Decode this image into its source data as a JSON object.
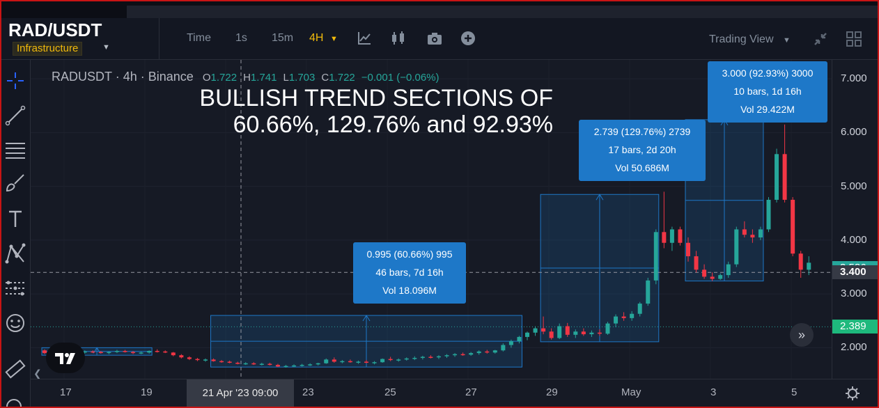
{
  "header": {
    "symbol": "RAD/USDT",
    "tag": "Infrastructure",
    "buttons": [
      "Time",
      "1s",
      "15m",
      "4H"
    ],
    "active_interval": "4H",
    "trading_view": "Trading View"
  },
  "legend": {
    "symbol": "RADUSDT",
    "interval": "4h",
    "exchange": "Binance",
    "o_label": "O",
    "o": "1.722",
    "h_label": "H",
    "h": "1.741",
    "l_label": "L",
    "l": "1.703",
    "c_label": "C",
    "c": "1.722",
    "change": "−0.001 (−0.06%)"
  },
  "annotation": {
    "line1": "BULLISH TREND SECTIONS OF",
    "line2": "60.66%, 129.76% and 92.93%"
  },
  "measures": [
    {
      "line1": "0.995 (60.66%) 995",
      "line2": "46 bars, 7d 16h",
      "line3": "Vol 18.096M"
    },
    {
      "line1": "2.739 (129.76%) 2739",
      "line2": "17 bars, 2d 20h",
      "line3": "Vol 50.686M"
    },
    {
      "line1": "3.000 (92.93%) 3000",
      "line2": "10 bars, 1d 16h",
      "line3": "Vol 29.422M"
    }
  ],
  "price_axis": {
    "labels": [
      "7.000",
      "6.000",
      "5.000",
      "4.000",
      "3.000",
      "2.000"
    ],
    "current_price": "2.389",
    "crosshair_price": "3.400",
    "partial_tag": "3.586"
  },
  "time_axis": {
    "labels": [
      "17",
      "19",
      "23",
      "25",
      "27",
      "29",
      "May",
      "3",
      "5"
    ],
    "crosshair_time": "21 Apr '23   09:00"
  },
  "chart_data": {
    "type": "candlestick",
    "ylim": [
      1.5,
      7.3
    ],
    "grid": true,
    "colors": {
      "up": "#26a69a",
      "down": "#f23645",
      "measure": "#1e78c8"
    },
    "candles": [
      [
        1.95,
        1.97,
        1.88,
        1.9
      ],
      [
        1.9,
        1.93,
        1.87,
        1.91
      ],
      [
        1.91,
        1.94,
        1.88,
        1.89
      ],
      [
        1.89,
        1.92,
        1.86,
        1.9
      ],
      [
        1.9,
        1.92,
        1.87,
        1.91
      ],
      [
        1.91,
        1.95,
        1.89,
        1.93
      ],
      [
        1.93,
        1.95,
        1.9,
        1.92
      ],
      [
        1.92,
        1.94,
        1.89,
        1.91
      ],
      [
        1.91,
        1.93,
        1.88,
        1.92
      ],
      [
        1.92,
        1.96,
        1.9,
        1.94
      ],
      [
        1.94,
        1.96,
        1.91,
        1.92
      ],
      [
        1.92,
        1.94,
        1.88,
        1.9
      ],
      [
        1.9,
        1.93,
        1.88,
        1.91
      ],
      [
        1.91,
        1.95,
        1.89,
        1.94
      ],
      [
        1.94,
        1.97,
        1.91,
        1.93
      ],
      [
        1.93,
        1.95,
        1.9,
        1.91
      ],
      [
        1.91,
        1.92,
        1.84,
        1.86
      ],
      [
        1.86,
        1.88,
        1.8,
        1.82
      ],
      [
        1.82,
        1.84,
        1.77,
        1.79
      ],
      [
        1.79,
        1.81,
        1.75,
        1.77
      ],
      [
        1.77,
        1.8,
        1.74,
        1.78
      ],
      [
        1.78,
        1.8,
        1.74,
        1.75
      ],
      [
        1.75,
        1.77,
        1.72,
        1.74
      ],
      [
        1.74,
        1.76,
        1.71,
        1.72
      ],
      [
        1.72,
        1.74,
        1.69,
        1.7
      ],
      [
        1.7,
        1.73,
        1.68,
        1.71
      ],
      [
        1.71,
        1.73,
        1.68,
        1.69
      ],
      [
        1.69,
        1.72,
        1.67,
        1.7
      ],
      [
        1.7,
        1.72,
        1.67,
        1.68
      ],
      [
        1.68,
        1.7,
        1.64,
        1.65
      ],
      [
        1.65,
        1.68,
        1.63,
        1.66
      ],
      [
        1.66,
        1.69,
        1.64,
        1.67
      ],
      [
        1.67,
        1.7,
        1.65,
        1.68
      ],
      [
        1.68,
        1.71,
        1.66,
        1.69
      ],
      [
        1.69,
        1.72,
        1.67,
        1.71
      ],
      [
        1.71,
        1.8,
        1.7,
        1.78
      ],
      [
        1.78,
        1.82,
        1.72,
        1.74
      ],
      [
        1.74,
        1.77,
        1.71,
        1.75
      ],
      [
        1.75,
        1.78,
        1.72,
        1.73
      ],
      [
        1.73,
        1.76,
        1.7,
        1.74
      ],
      [
        1.74,
        1.77,
        1.71,
        1.72
      ],
      [
        1.72,
        1.75,
        1.69,
        1.73
      ],
      [
        1.73,
        1.8,
        1.72,
        1.79
      ],
      [
        1.79,
        1.83,
        1.75,
        1.77
      ],
      [
        1.77,
        1.8,
        1.74,
        1.78
      ],
      [
        1.78,
        1.82,
        1.76,
        1.8
      ],
      [
        1.8,
        1.84,
        1.77,
        1.81
      ],
      [
        1.81,
        1.85,
        1.78,
        1.83
      ],
      [
        1.83,
        1.86,
        1.8,
        1.82
      ],
      [
        1.82,
        1.86,
        1.79,
        1.84
      ],
      [
        1.84,
        1.88,
        1.81,
        1.86
      ],
      [
        1.86,
        1.9,
        1.83,
        1.88
      ],
      [
        1.88,
        1.91,
        1.85,
        1.87
      ],
      [
        1.87,
        1.92,
        1.85,
        1.9
      ],
      [
        1.9,
        1.95,
        1.87,
        1.93
      ],
      [
        1.93,
        1.96,
        1.89,
        1.91
      ],
      [
        1.91,
        1.96,
        1.89,
        1.95
      ],
      [
        1.95,
        2.08,
        1.93,
        2.05
      ],
      [
        2.05,
        2.15,
        2.0,
        2.12
      ],
      [
        2.12,
        2.22,
        2.08,
        2.2
      ],
      [
        2.2,
        2.3,
        2.14,
        2.28
      ],
      [
        2.28,
        2.4,
        2.22,
        2.36
      ],
      [
        2.36,
        2.58,
        2.25,
        2.3
      ],
      [
        2.3,
        2.36,
        2.15,
        2.18
      ],
      [
        2.18,
        2.45,
        2.16,
        2.4
      ],
      [
        2.4,
        2.46,
        2.2,
        2.24
      ],
      [
        2.24,
        2.34,
        2.18,
        2.3
      ],
      [
        2.3,
        2.36,
        2.22,
        2.25
      ],
      [
        2.25,
        2.32,
        2.2,
        2.28
      ],
      [
        2.28,
        2.34,
        2.22,
        2.26
      ],
      [
        2.26,
        2.48,
        2.24,
        2.45
      ],
      [
        2.45,
        2.62,
        2.38,
        2.58
      ],
      [
        2.58,
        2.66,
        2.5,
        2.55
      ],
      [
        2.55,
        2.68,
        2.5,
        2.63
      ],
      [
        2.63,
        2.85,
        2.58,
        2.82
      ],
      [
        2.82,
        3.3,
        2.78,
        3.25
      ],
      [
        3.25,
        4.2,
        3.18,
        4.15
      ],
      [
        4.15,
        4.9,
        3.85,
        3.95
      ],
      [
        3.95,
        4.25,
        3.8,
        4.2
      ],
      [
        4.2,
        4.25,
        3.9,
        3.95
      ],
      [
        3.95,
        4.05,
        3.6,
        3.7
      ],
      [
        3.7,
        3.8,
        3.4,
        3.45
      ],
      [
        3.45,
        3.55,
        3.28,
        3.32
      ],
      [
        3.32,
        3.4,
        3.24,
        3.28
      ],
      [
        3.28,
        3.38,
        3.26,
        3.35
      ],
      [
        3.35,
        3.6,
        3.3,
        3.55
      ],
      [
        3.55,
        4.25,
        3.5,
        4.2
      ],
      [
        4.2,
        4.35,
        4.05,
        4.1
      ],
      [
        4.1,
        4.2,
        3.95,
        4.05
      ],
      [
        4.05,
        4.25,
        4.0,
        4.2
      ],
      [
        4.2,
        4.8,
        4.15,
        4.75
      ],
      [
        4.75,
        5.7,
        4.7,
        5.6
      ],
      [
        5.6,
        6.15,
        4.7,
        4.75
      ],
      [
        4.75,
        4.8,
        3.7,
        3.75
      ],
      [
        3.75,
        3.8,
        3.3,
        3.45
      ],
      [
        3.45,
        3.7,
        3.35,
        3.58
      ]
    ],
    "measure_boxes": [
      {
        "from_index": 21,
        "to_index": 59,
        "low": 1.64,
        "high": 2.6
      },
      {
        "from_index": 62,
        "to_index": 76,
        "low": 2.11,
        "high": 4.85
      },
      {
        "from_index": 80,
        "to_index": 89,
        "low": 3.24,
        "high": 6.24
      }
    ],
    "initial_box": {
      "from_index": 0,
      "to_index": 13,
      "low": 1.86,
      "high": 2.0
    }
  }
}
